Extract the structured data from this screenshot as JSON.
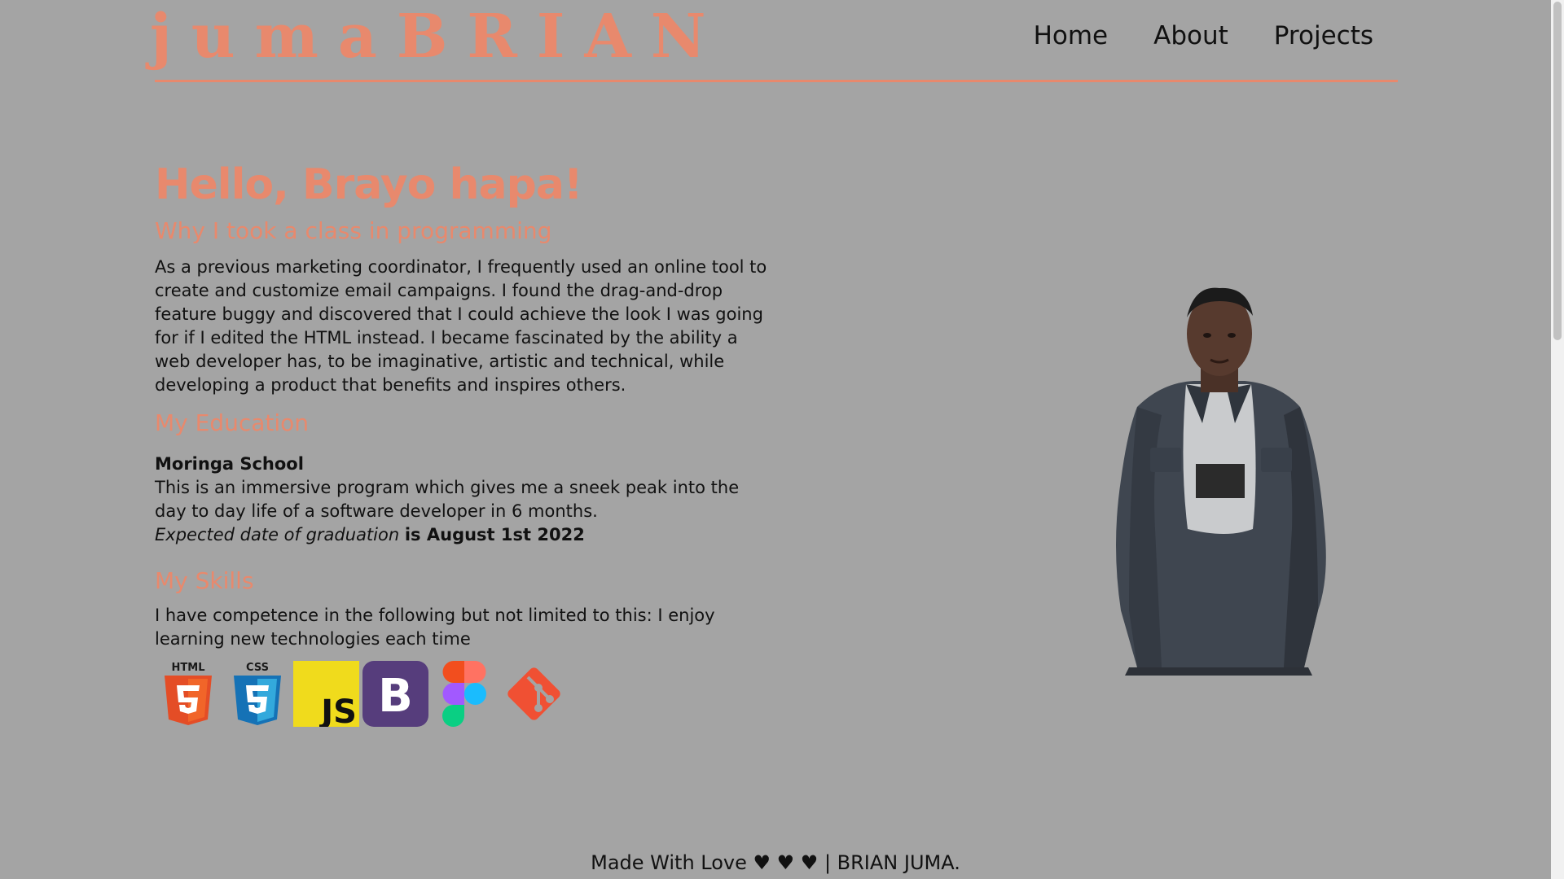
{
  "header": {
    "logo_text": "jumaBRIAN",
    "nav": [
      {
        "label": "Home"
      },
      {
        "label": "About"
      },
      {
        "label": "Projects"
      }
    ]
  },
  "main": {
    "greeting": "Hello, Brayo hapa!",
    "why_heading": "Why I took a class in programming",
    "why_text": "As a previous marketing coordinator, I frequently used an online tool to create and customize email campaigns. I found the drag-and-drop feature buggy and discovered that I could achieve the look I was going for if I edited the HTML instead. I became fascinated by the ability a web developer has, to be imaginative, artistic and technical, while developing a product that benefits and inspires others.",
    "education_heading": "My Education",
    "school_name": "Moringa School",
    "education_text": "This is an immersive program which gives me a sneek peak into the day to day life of a software developer in 6 months.",
    "expected_label": "Expected date of graduation",
    "expected_value": "is August 1st 2022",
    "skills_heading": "My Skills",
    "skills_text": "I have competence in the following but not limited to this: I enjoy learning new technologies each time",
    "skills": [
      {
        "name": "html5-icon",
        "label": "HTML"
      },
      {
        "name": "css3-icon",
        "label": "CSS"
      },
      {
        "name": "javascript-icon",
        "label": "JS"
      },
      {
        "name": "bootstrap-icon",
        "label": "B"
      },
      {
        "name": "figma-icon"
      },
      {
        "name": "git-icon"
      }
    ]
  },
  "footer": {
    "text": "Made With Love ♥ ♥ ♥  | BRIAN JUMA."
  },
  "colors": {
    "accent": "#e8896d",
    "background": "#a4a4a4"
  }
}
